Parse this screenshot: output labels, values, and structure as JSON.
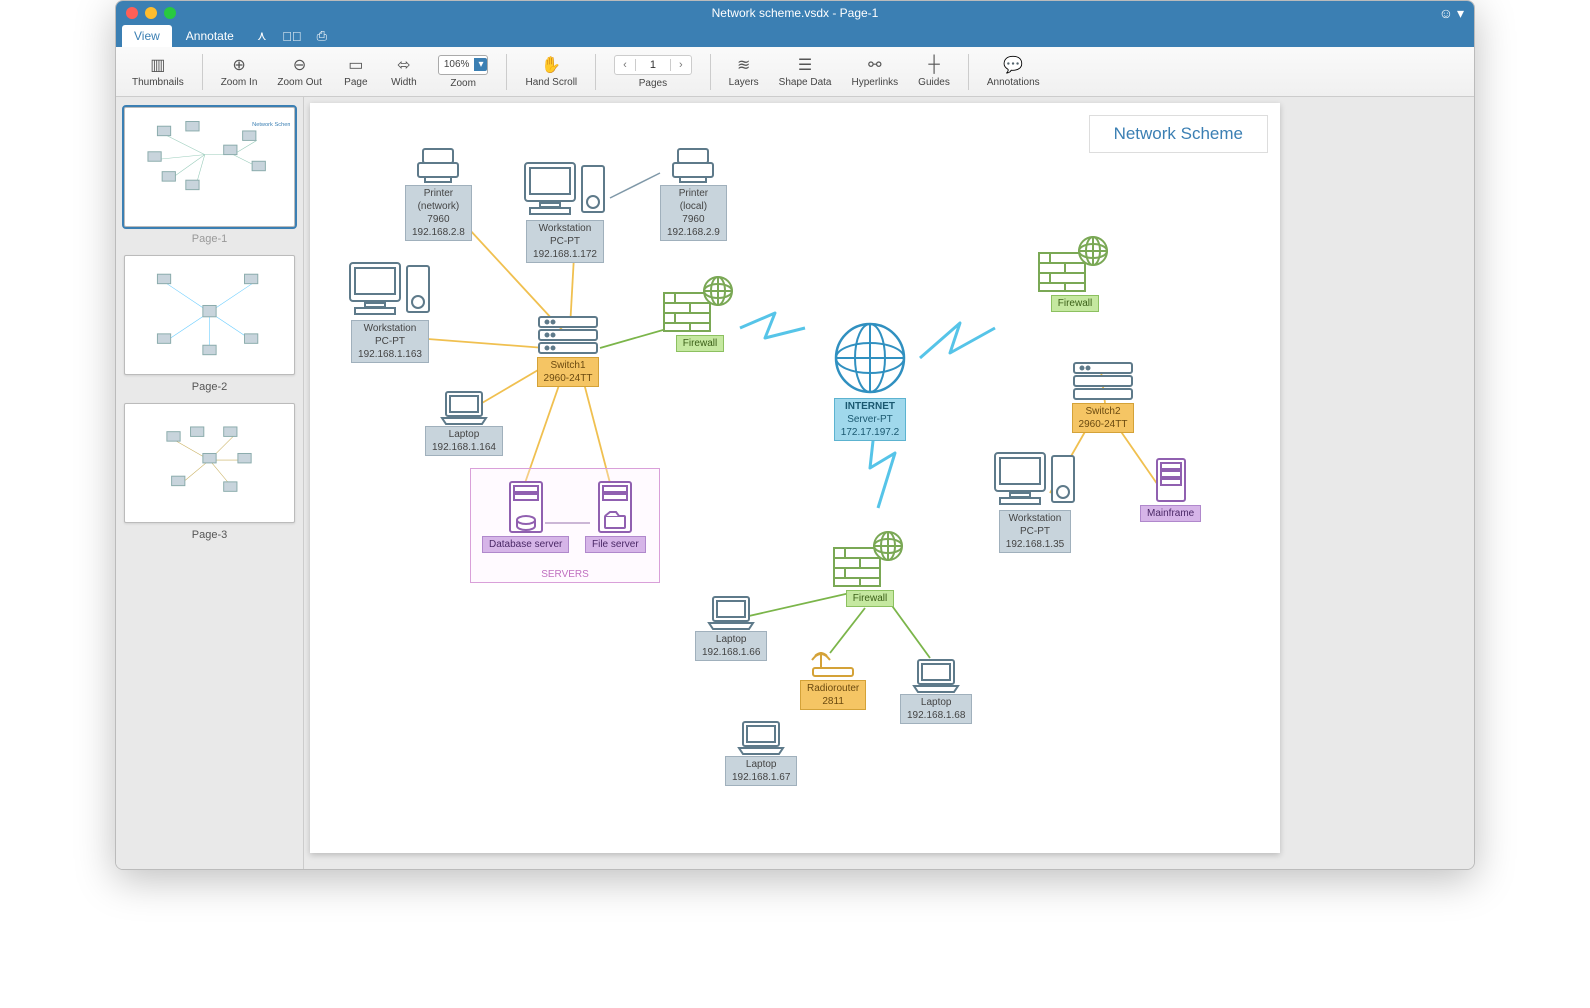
{
  "window": {
    "title": "Network scheme.vsdx - Page-1"
  },
  "menubar": {
    "tabs": [
      "View",
      "Annotate"
    ],
    "active": 0
  },
  "toolbar": {
    "thumbnails": "Thumbnails",
    "zoom_in": "Zoom In",
    "zoom_out": "Zoom Out",
    "page": "Page",
    "width": "Width",
    "zoom": "Zoom",
    "zoom_value": "106%",
    "hand_scroll": "Hand Scroll",
    "pages": "Pages",
    "page_num": "1",
    "layers": "Layers",
    "shape_data": "Shape Data",
    "hyperlinks": "Hyperlinks",
    "guides": "Guides",
    "annotations": "Annotations"
  },
  "thumbs": [
    "Page-1",
    "Page-2",
    "Page-3"
  ],
  "diagram": {
    "title": "Network Scheme",
    "nodes": {
      "printer_net": {
        "lines": [
          "Printer",
          "(network)",
          "7960",
          "192.168.2.8"
        ]
      },
      "printer_local": {
        "lines": [
          "Printer",
          "(local)",
          "7960",
          "192.168.2.9"
        ]
      },
      "workstation1": {
        "lines": [
          "Workstation",
          "PC-PT",
          "192.168.1.172"
        ]
      },
      "workstation2": {
        "lines": [
          "Workstation",
          "PC-PT",
          "192.168.1.163"
        ]
      },
      "laptop1": {
        "lines": [
          "Laptop",
          "192.168.1.164"
        ]
      },
      "switch1": {
        "lines": [
          "Switch1",
          "2960-24TT"
        ]
      },
      "firewall1": {
        "lines": [
          "Firewall"
        ]
      },
      "internet": {
        "lines": [
          "INTERNET",
          "Server-PT",
          "172.17.197.2"
        ]
      },
      "firewall2": {
        "lines": [
          "Firewall"
        ]
      },
      "switch2": {
        "lines": [
          "Switch2",
          "2960-24TT"
        ]
      },
      "workstation3": {
        "lines": [
          "Workstation",
          "PC-PT",
          "192.168.1.35"
        ]
      },
      "mainframe": {
        "lines": [
          "Mainframe"
        ]
      },
      "firewall3": {
        "lines": [
          "Firewall"
        ]
      },
      "laptop2": {
        "lines": [
          "Laptop",
          "192.168.1.66"
        ]
      },
      "laptop3": {
        "lines": [
          "Laptop",
          "192.168.1.67"
        ]
      },
      "laptop4": {
        "lines": [
          "Laptop",
          "192.168.1.68"
        ]
      },
      "radiorouter": {
        "lines": [
          "Radiorouter",
          "2811"
        ]
      },
      "db_server": {
        "lines": [
          "Database server"
        ]
      },
      "file_server": {
        "lines": [
          "File server"
        ]
      }
    },
    "servers_group": "SERVERS"
  }
}
